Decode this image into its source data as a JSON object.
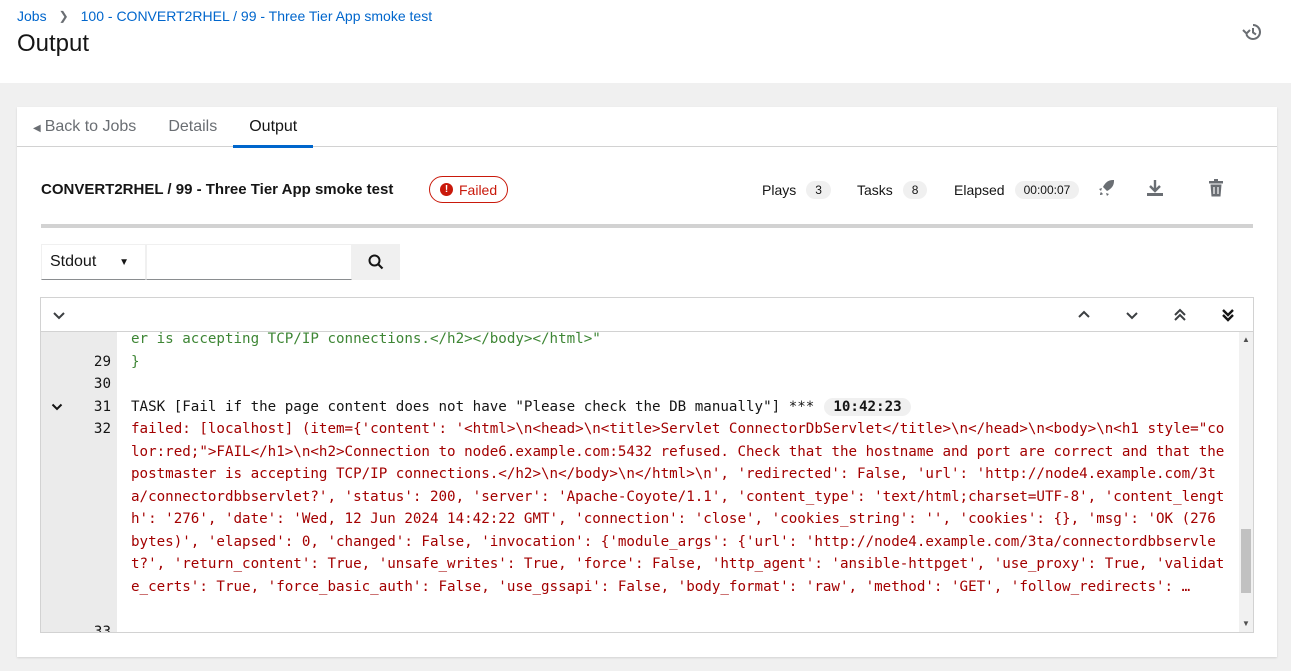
{
  "breadcrumb": {
    "jobs": "Jobs",
    "current": "100 - CONVERT2RHEL / 99 - Three Tier App smoke test"
  },
  "page": {
    "title": "Output"
  },
  "tabs": {
    "back": "Back to Jobs",
    "details": "Details",
    "output": "Output"
  },
  "job": {
    "title": "CONVERT2RHEL / 99 - Three Tier App smoke test",
    "status": "Failed",
    "plays_label": "Plays",
    "plays": "3",
    "tasks_label": "Tasks",
    "tasks": "8",
    "elapsed_label": "Elapsed",
    "elapsed": "00:00:07"
  },
  "filter": {
    "selected": "Stdout",
    "search_value": ""
  },
  "colors": {
    "accent": "#0066cc",
    "failed": "#c9190b",
    "ok_text": "#3e8635",
    "error_text": "#a30000"
  },
  "output": {
    "lines": [
      {
        "num": "",
        "text": "er is accepting TCP/IP connections.</h2></body></html>\""
      },
      {
        "num": "29",
        "text": "}"
      },
      {
        "num": "30",
        "text": ""
      },
      {
        "num": "31",
        "text": "TASK [Fail if the page content does not have \"Please check the DB manually\"] ***",
        "timestamp": "10:42:23"
      },
      {
        "num": "32",
        "text": "failed: [localhost] (item={'content': '<html>\\n<head>\\n<title>Servlet ConnectorDbServlet</title>\\n</head>\\n<body>\\n<h1 style=\"color:red;\">FAIL</h1>\\n<h2>Connection to node6.example.com:5432 refused. Check that the hostname and port are correct and that the postmaster is accepting TCP/IP connections.</h2>\\n</body>\\n</html>\\n', 'redirected': False, 'url': 'http://node4.example.com/3ta/connectordbbservlet?', 'status': 200, 'server': 'Apache-Coyote/1.1', 'content_type': 'text/html;charset=UTF-8', 'content_length': '276', 'date': 'Wed, 12 Jun 2024 14:42:22 GMT', 'connection': 'close', 'cookies_string': '', 'cookies': {}, 'msg': 'OK (276 bytes)', 'elapsed': 0, 'changed': False, 'invocation': {'module_args': {'url': 'http://node4.example.com/3ta/connectordbbservlet?', 'return_content': True, 'unsafe_writes': True, 'force': False, 'http_agent': 'ansible-httpget', 'use_proxy': True, 'validate_certs': True, 'force_basic_auth': False, 'use_gssapi': False, 'body_format': 'raw', 'method': 'GET', 'follow_redirects': …"
      },
      {
        "num": "33",
        "text": ""
      }
    ]
  }
}
